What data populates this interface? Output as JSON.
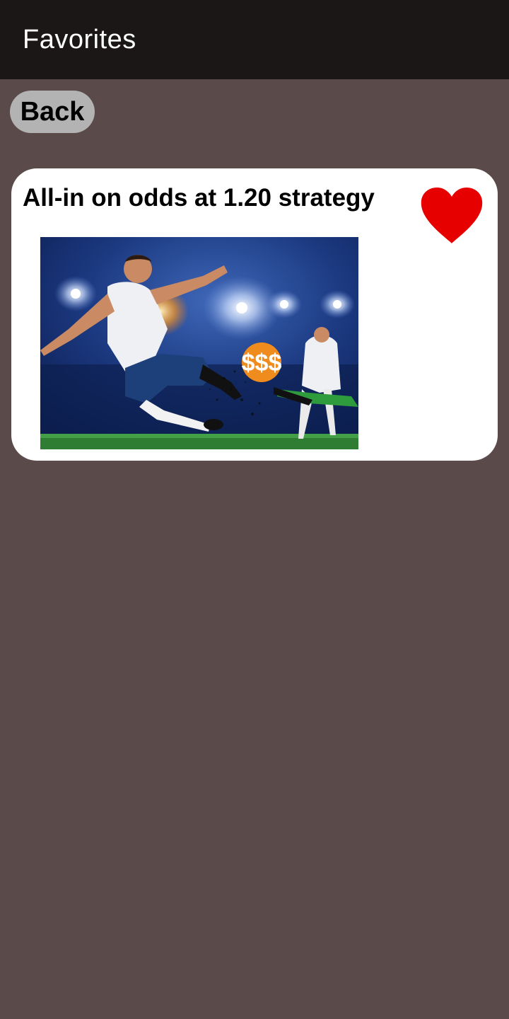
{
  "app_bar": {
    "title": "Favorites"
  },
  "back_button": {
    "label": "Back"
  },
  "favorites": [
    {
      "title": "All-in on odds at 1.20 strategy",
      "favorited": true,
      "image_alt": "soccer-player-kick-illustration",
      "coin_text": "$$$"
    }
  ],
  "colors": {
    "background": "#5b4a4a",
    "app_bar": "#1c1717",
    "back_button": "#b3b3b3",
    "heart": "#e60000"
  }
}
